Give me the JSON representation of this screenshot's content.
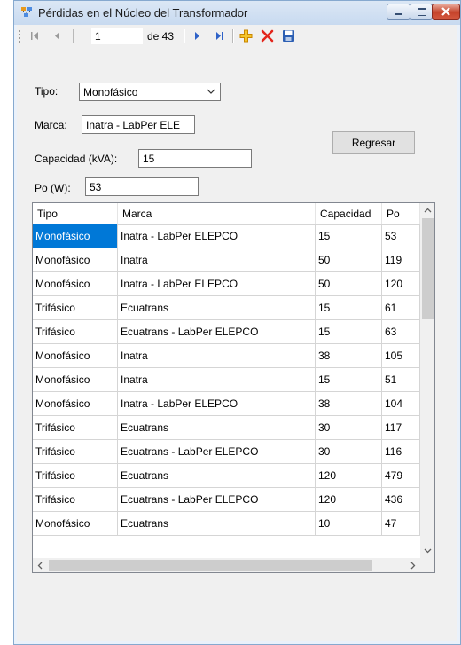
{
  "window": {
    "title": "Pérdidas en el Núcleo del Transformador"
  },
  "navigator": {
    "position": "1",
    "of_label": "de 43"
  },
  "form": {
    "tipo_label": "Tipo:",
    "tipo_value": "Monofásico",
    "marca_label": "Marca:",
    "marca_value": "Inatra - LabPer ELE",
    "capacidad_label": "Capacidad (kVA):",
    "capacidad_value": "15",
    "po_label": "Po (W):",
    "po_value": "53",
    "regresar_label": "Regresar"
  },
  "grid": {
    "columns": [
      "Tipo",
      "Marca",
      "Capacidad",
      "Po"
    ],
    "rows": [
      [
        "Monofásico",
        "Inatra - LabPer ELEPCO",
        "15",
        "53"
      ],
      [
        "Monofásico",
        "Inatra",
        "50",
        "119"
      ],
      [
        "Monofásico",
        "Inatra - LabPer ELEPCO",
        "50",
        "120"
      ],
      [
        "Trifásico",
        "Ecuatrans",
        "15",
        "61"
      ],
      [
        "Trifásico",
        "Ecuatrans - LabPer ELEPCO",
        "15",
        "63"
      ],
      [
        "Monofásico",
        "Inatra",
        "38",
        "105"
      ],
      [
        "Monofásico",
        "Inatra",
        "15",
        "51"
      ],
      [
        "Monofásico",
        "Inatra - LabPer ELEPCO",
        "38",
        "104"
      ],
      [
        "Trifásico",
        "Ecuatrans",
        "30",
        "117"
      ],
      [
        "Trifásico",
        "Ecuatrans - LabPer ELEPCO",
        "30",
        "116"
      ],
      [
        "Trifásico",
        "Ecuatrans",
        "120",
        "479"
      ],
      [
        "Trifásico",
        "Ecuatrans - LabPer ELEPCO",
        "120",
        "436"
      ],
      [
        "Monofásico",
        "Ecuatrans",
        "10",
        "47"
      ]
    ],
    "selected_row": 0
  },
  "icons": {
    "app": "datasource-icon",
    "first": "move-first-icon",
    "prev": "move-previous-icon",
    "next": "move-next-icon",
    "last": "move-last-icon",
    "add": "add-new-icon",
    "delete": "delete-icon",
    "save": "save-icon"
  },
  "colors": {
    "selection": "#0078d7",
    "close_button": "#c5432b",
    "add_icon": "#e8a600",
    "delete_icon": "#e3261c",
    "nav_icon": "#2e62c8"
  }
}
